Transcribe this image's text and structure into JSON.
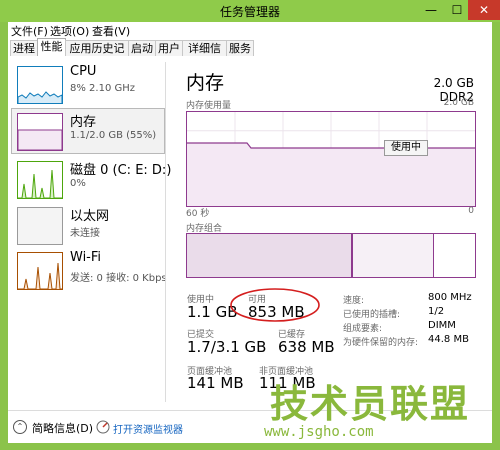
{
  "window": {
    "title": "任务管理器",
    "minimize": "—",
    "maximize": "☐",
    "close": "✕"
  },
  "menu": [
    "文件(F)",
    "选项(O)",
    "查看(V)"
  ],
  "tabs": [
    "进程",
    "性能",
    "应用历史记录",
    "启动",
    "用户",
    "详细信息",
    "服务"
  ],
  "active_tab": "性能",
  "sidebar": [
    {
      "name": "CPU",
      "sub": "8% 2.10 GHz"
    },
    {
      "name": "内存",
      "sub": "1.1/2.0 GB (55%)"
    },
    {
      "name": "磁盘 0 (C: E: D:)",
      "sub": "0%"
    },
    {
      "name": "以太网",
      "sub": "未连接"
    },
    {
      "name": "Wi-Fi",
      "sub": "发送: 0 接收: 0 Kbps"
    }
  ],
  "memory": {
    "heading": "内存",
    "capacity": "2.0 GB DDR2",
    "usage_label": "内存使用量",
    "usage_max": "2.0 GB",
    "time_left": "60 秒",
    "time_right": "0",
    "composition_label": "内存组合",
    "tooltip": "使用中",
    "stats": {
      "in_use_label": "使用中",
      "in_use": "1.1 GB",
      "available_label": "可用",
      "available": "853 MB",
      "committed_label": "已提交",
      "committed": "1.7/3.1 GB",
      "cached_label": "已缓存",
      "cached": "638 MB",
      "paged_label": "页面缓冲池",
      "paged": "141 MB",
      "nonpaged_label": "非页面缓冲池",
      "nonpaged": "111 MB"
    },
    "details": {
      "speed_label": "速度:",
      "speed": "800 MHz",
      "slots_label": "已使用的插槽:",
      "slots": "1/2",
      "form_label": "组成要素:",
      "form": "DIMM",
      "reserved_label": "为硬件保留的内存:",
      "reserved": "44.8 MB"
    }
  },
  "footer": {
    "less_details": "简略信息(D)",
    "open_monitor": "打开资源监视器"
  },
  "watermark": {
    "main": "技术员联盟",
    "url": "www.jsgho.com"
  },
  "colors": {
    "frame": "#8bc34a",
    "memory_accent": "#8e3a8e",
    "cpu_accent": "#117dbb",
    "disk_accent": "#4da60c",
    "wifi_accent": "#a74f01"
  }
}
